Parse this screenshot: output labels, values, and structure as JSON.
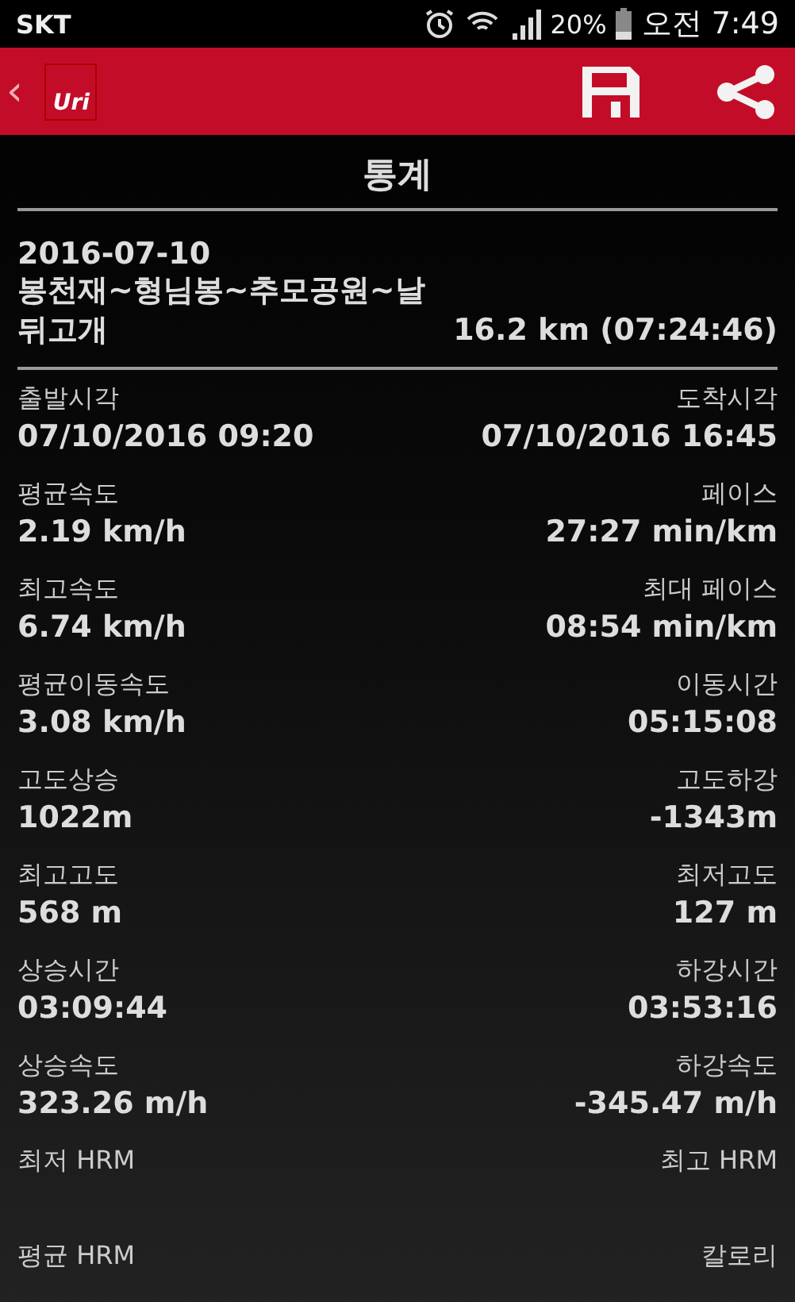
{
  "status_bar": {
    "carrier": "SKT",
    "battery": "20%",
    "time": "오전 7:49"
  },
  "app_bar": {
    "back": "‹",
    "logo": "Uri"
  },
  "title": "통계",
  "track": {
    "date": "2016-07-10",
    "name": "봉천재~형님봉~추모공원~날뒤고개",
    "distance": "16.2 km (07:24:46)"
  },
  "stats": [
    {
      "left": {
        "label": "출발시각",
        "value": "07/10/2016 09:20"
      },
      "right": {
        "label": "도착시각",
        "value": "07/10/2016 16:45"
      }
    },
    {
      "left": {
        "label": "평균속도",
        "value": "2.19 km/h"
      },
      "right": {
        "label": "페이스",
        "value": "27:27 min/km"
      }
    },
    {
      "left": {
        "label": "최고속도",
        "value": "6.74 km/h"
      },
      "right": {
        "label": "최대 페이스",
        "value": "08:54 min/km"
      }
    },
    {
      "left": {
        "label": "평균이동속도",
        "value": "3.08 km/h"
      },
      "right": {
        "label": "이동시간",
        "value": "05:15:08"
      }
    },
    {
      "left": {
        "label": "고도상승",
        "value": "1022m"
      },
      "right": {
        "label": "고도하강",
        "value": "-1343m"
      }
    },
    {
      "left": {
        "label": "최고고도",
        "value": "568 m"
      },
      "right": {
        "label": "최저고도",
        "value": "127 m"
      }
    },
    {
      "left": {
        "label": "상승시간",
        "value": "03:09:44"
      },
      "right": {
        "label": "하강시간",
        "value": "03:53:16"
      }
    },
    {
      "left": {
        "label": "상승속도",
        "value": "323.26 m/h"
      },
      "right": {
        "label": "하강속도",
        "value": "-345.47 m/h"
      }
    },
    {
      "left": {
        "label": "최저 HRM"
      },
      "right": {
        "label": "최고 HRM"
      }
    },
    {
      "left": {
        "label": "평균 HRM"
      },
      "right": {
        "label": "칼로리"
      }
    }
  ]
}
